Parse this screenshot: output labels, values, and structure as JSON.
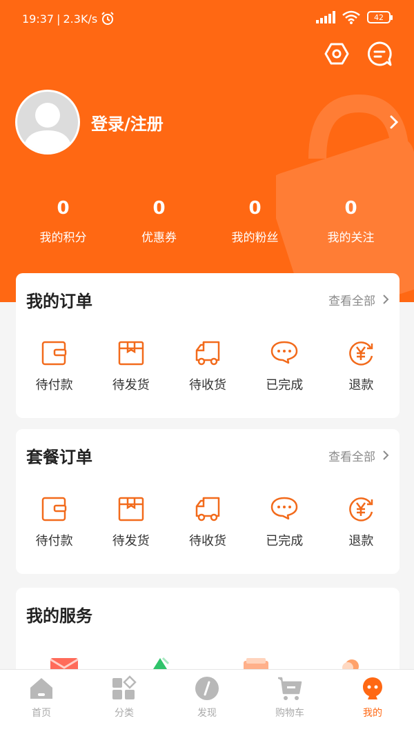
{
  "status": {
    "time": "19:37",
    "speed": "2.3K/s",
    "battery": "42"
  },
  "colors": {
    "accent": "#ff6813",
    "hero": "#ff6813",
    "icon_stroke": "#f26a1b"
  },
  "header": {
    "settings_icon": "hex-settings-icon",
    "message_icon": "chat-message-icon"
  },
  "profile": {
    "login_label": "登录/注册"
  },
  "stats": [
    {
      "value": "0",
      "label": "我的积分"
    },
    {
      "value": "0",
      "label": "优惠券"
    },
    {
      "value": "0",
      "label": "我的粉丝"
    },
    {
      "value": "0",
      "label": "我的关注"
    }
  ],
  "orders": {
    "title": "我的订单",
    "view_all": "查看全部",
    "items": [
      {
        "label": "待付款",
        "icon": "wallet-icon"
      },
      {
        "label": "待发货",
        "icon": "package-icon"
      },
      {
        "label": "待收货",
        "icon": "truck-icon"
      },
      {
        "label": "已完成",
        "icon": "chat-dots-icon"
      },
      {
        "label": "退款",
        "icon": "yen-refund-icon"
      }
    ]
  },
  "package_orders": {
    "title": "套餐订单",
    "view_all": "查看全部",
    "items": [
      {
        "label": "待付款",
        "icon": "wallet-icon"
      },
      {
        "label": "待发货",
        "icon": "package-icon"
      },
      {
        "label": "待收货",
        "icon": "truck-icon"
      },
      {
        "label": "已完成",
        "icon": "chat-dots-icon"
      },
      {
        "label": "退款",
        "icon": "yen-refund-icon"
      }
    ]
  },
  "services": {
    "title": "我的服务"
  },
  "tabbar": [
    {
      "label": "首页",
      "icon": "home-icon",
      "active": false
    },
    {
      "label": "分类",
      "icon": "category-icon",
      "active": false
    },
    {
      "label": "发现",
      "icon": "compass-icon",
      "active": false
    },
    {
      "label": "购物车",
      "icon": "cart-icon",
      "active": false
    },
    {
      "label": "我的",
      "icon": "profile-icon",
      "active": true
    }
  ]
}
